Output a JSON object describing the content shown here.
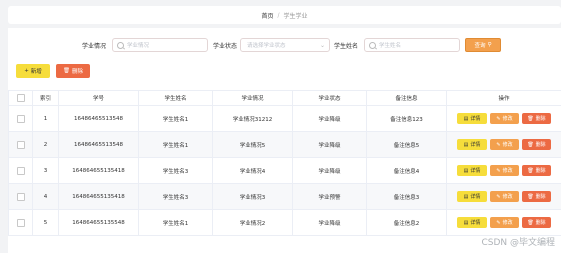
{
  "breadcrumb": {
    "home": "首页",
    "separator": "/",
    "current": "学生学业"
  },
  "filters": {
    "status_label": "学业情况",
    "status_placeholder": "学业情况",
    "state_label": "学业状态",
    "state_placeholder": "请选择学业状态",
    "name_label": "学生姓名",
    "name_placeholder": "学生姓名",
    "search_button": "查询"
  },
  "actions": {
    "add_button": "新增",
    "delete_button": "删除"
  },
  "table": {
    "headers": [
      "",
      "索引",
      "学号",
      "学生姓名",
      "学业情况",
      "学业状态",
      "备注信息",
      "操作"
    ],
    "row_buttons": {
      "detail": "详情",
      "edit": "修改",
      "delete": "删除"
    },
    "rows": [
      {
        "index": "1",
        "student_id": "164864655135​48",
        "name": "学生姓名1",
        "situation": "学业情况31212",
        "state": "学业降级",
        "note": "备注信息123"
      },
      {
        "index": "2",
        "student_id": "164864655135​48",
        "name": "学生姓名1",
        "situation": "学业情况5",
        "state": "学业降级",
        "note": "备注信息5"
      },
      {
        "index": "3",
        "student_id": "164864655135418",
        "name": "学生姓名3",
        "situation": "学业情况4",
        "state": "学业降级",
        "note": "备注信息4"
      },
      {
        "index": "4",
        "student_id": "164864655135418",
        "name": "学生姓名3",
        "situation": "学业情况3",
        "state": "学业预警",
        "note": "备注信息3"
      },
      {
        "index": "5",
        "student_id": "164864655135548",
        "name": "学生姓名1",
        "situation": "学业情况2",
        "state": "学业降级",
        "note": "备注信息2"
      }
    ]
  },
  "watermark": "CSDN @毕文编程"
}
